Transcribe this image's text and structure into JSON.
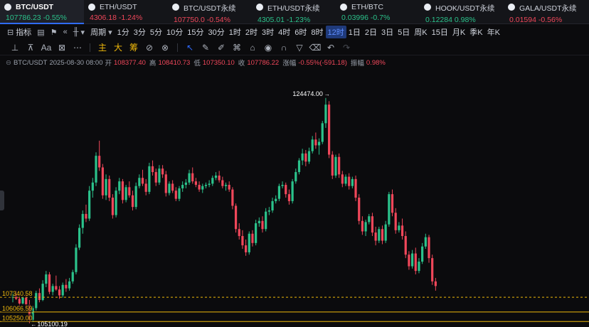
{
  "tickers": [
    {
      "symbol": "BTC/USDT",
      "price": "107786.23",
      "change": "-0.55%",
      "price_dir": "up",
      "change_dir": "up",
      "active": true
    },
    {
      "symbol": "ETH/USDT",
      "price": "4306.18",
      "change": "-1.24%",
      "price_dir": "down",
      "change_dir": "down",
      "active": false
    },
    {
      "symbol": "BTC/USDT永续",
      "price": "107750.0",
      "change": "-0.54%",
      "price_dir": "down",
      "change_dir": "down",
      "active": false
    },
    {
      "symbol": "ETH/USDT永续",
      "price": "4305.01",
      "change": "-1.23%",
      "price_dir": "up",
      "change_dir": "up",
      "active": false
    },
    {
      "symbol": "ETH/BTC",
      "price": "0.03996",
      "change": "-0.7%",
      "price_dir": "up",
      "change_dir": "up",
      "active": false
    },
    {
      "symbol": "HOOK/USDT永续",
      "price": "0.12284",
      "change": "0.98%",
      "price_dir": "up",
      "change_dir": "up",
      "active": false
    },
    {
      "symbol": "GALA/USDT永续",
      "price": "0.01594",
      "change": "-0.56%",
      "price_dir": "down",
      "change_dir": "down",
      "active": false
    }
  ],
  "toolbar": {
    "indicator_label": "指标",
    "period_label": "周期",
    "timeframes": [
      "1分",
      "3分",
      "5分",
      "10分",
      "15分",
      "30分",
      "1时",
      "2时",
      "3时",
      "4时",
      "6时",
      "8时",
      "12时",
      "1日",
      "2日",
      "3日",
      "5日",
      "周K",
      "15日",
      "月K",
      "季K",
      "年K"
    ],
    "selected_timeframe": "12时"
  },
  "drawing_tools": {
    "main_label": "主",
    "big_label": "大",
    "chip_label": "筹"
  },
  "info": {
    "pair": "BTC/USDT",
    "datetime": "2025-08-30 08:00",
    "open_label": "开",
    "open": "108377.40",
    "high_label": "高",
    "high": "108410.73",
    "low_label": "低",
    "low": "107350.10",
    "close_label": "收",
    "close": "107786.22",
    "change_label": "涨幅",
    "change": "-0.55%(-591.18)",
    "amplitude_label": "振幅",
    "amplitude": "0.98%"
  },
  "chart_data": {
    "type": "candlestick",
    "symbol": "BTC/USDT",
    "interval": "12时",
    "high_marker": "124474.00",
    "low_marker": "105100.19",
    "price_lines": [
      {
        "label": "107340.58",
        "value": 107340.58,
        "style": "dashed",
        "color": "#f0b90b"
      },
      {
        "label": "106066.59",
        "value": 106066.59,
        "style": "solid",
        "color": "#f0b90b"
      },
      {
        "label": "105250.00",
        "value": 105250.0,
        "style": "solid",
        "color": "#f0b90b"
      }
    ],
    "price_axis": {
      "min": 104900,
      "max": 125500
    },
    "colors": {
      "up": "#2bc28b",
      "down": "#f0475a",
      "line": "#f0b90b"
    },
    "ohlc": [
      [
        107300,
        107800,
        106900,
        107600
      ],
      [
        107600,
        107900,
        107100,
        107200
      ],
      [
        107200,
        107500,
        106500,
        106800
      ],
      [
        106800,
        107400,
        106700,
        107300
      ],
      [
        107300,
        107600,
        106400,
        106700
      ],
      [
        106700,
        107100,
        105100,
        105400
      ],
      [
        105400,
        106600,
        105200,
        106400
      ],
      [
        106400,
        107900,
        106200,
        107700
      ],
      [
        107700,
        108100,
        106900,
        107100
      ],
      [
        107100,
        108800,
        107000,
        108500
      ],
      [
        108500,
        109600,
        108200,
        109300
      ],
      [
        109300,
        109500,
        107600,
        107800
      ],
      [
        107800,
        108500,
        107500,
        108300
      ],
      [
        108300,
        109200,
        107900,
        108000
      ],
      [
        108000,
        108300,
        107200,
        107500
      ],
      [
        107500,
        108600,
        107300,
        108400
      ],
      [
        108400,
        108900,
        107800,
        108100
      ],
      [
        108100,
        109000,
        107900,
        108700
      ],
      [
        108700,
        109700,
        108500,
        109500
      ],
      [
        109500,
        111900,
        109300,
        111600
      ],
      [
        111600,
        113600,
        111400,
        113300
      ],
      [
        113300,
        114800,
        112800,
        114500
      ],
      [
        114500,
        115300,
        113800,
        114100
      ],
      [
        114100,
        116900,
        113900,
        116500
      ],
      [
        116500,
        117600,
        115900,
        117200
      ],
      [
        117200,
        119800,
        116900,
        119500
      ],
      [
        119500,
        120800,
        118200,
        118500
      ],
      [
        118500,
        118800,
        115800,
        116100
      ],
      [
        116100,
        117900,
        115700,
        117500
      ],
      [
        117500,
        117800,
        115600,
        115900
      ],
      [
        115900,
        116200,
        114100,
        114400
      ],
      [
        114400,
        116800,
        114200,
        116500
      ],
      [
        116500,
        117600,
        116200,
        117300
      ],
      [
        117300,
        117500,
        115400,
        115700
      ],
      [
        115700,
        117000,
        115500,
        116800
      ],
      [
        116800,
        117300,
        115900,
        116100
      ],
      [
        116100,
        116500,
        114800,
        115100
      ],
      [
        115100,
        117200,
        114900,
        116900
      ],
      [
        116900,
        117900,
        116700,
        117600
      ],
      [
        117600,
        118300,
        116900,
        117100
      ],
      [
        117100,
        117500,
        116100,
        116400
      ],
      [
        116400,
        118900,
        116200,
        118600
      ],
      [
        118600,
        119100,
        117800,
        118100
      ],
      [
        118100,
        118400,
        116900,
        117200
      ],
      [
        117200,
        118700,
        117000,
        118400
      ],
      [
        118400,
        118700,
        117600,
        117900
      ],
      [
        117900,
        118200,
        116000,
        116300
      ],
      [
        116300,
        117300,
        116100,
        117100
      ],
      [
        117100,
        117400,
        116300,
        116500
      ],
      [
        116500,
        116800,
        115600,
        115800
      ],
      [
        115800,
        116900,
        115600,
        116700
      ],
      [
        116700,
        117300,
        116400,
        117000
      ],
      [
        117000,
        117500,
        116700,
        117200
      ],
      [
        117200,
        118300,
        117000,
        118000
      ],
      [
        118000,
        118500,
        117100,
        117300
      ],
      [
        117300,
        117600,
        116800,
        117000
      ],
      [
        117000,
        117300,
        116400,
        116600
      ],
      [
        116600,
        117100,
        116300,
        116900
      ],
      [
        116900,
        117200,
        116700,
        117000
      ],
      [
        117000,
        117400,
        116800,
        117100
      ],
      [
        117100,
        117800,
        116900,
        117600
      ],
      [
        117600,
        118100,
        117400,
        117800
      ],
      [
        117800,
        118200,
        117200,
        117400
      ],
      [
        117400,
        117700,
        116700,
        116900
      ],
      [
        116900,
        117200,
        116500,
        117000
      ],
      [
        117000,
        117300,
        116400,
        116600
      ],
      [
        116600,
        116800,
        114900,
        115200
      ],
      [
        115200,
        115400,
        112900,
        113200
      ],
      [
        113200,
        113700,
        112300,
        112600
      ],
      [
        112600,
        113100,
        111500,
        111800
      ],
      [
        111800,
        112300,
        110900,
        111200
      ],
      [
        111200,
        113000,
        111000,
        112800
      ],
      [
        112800,
        113100,
        111700,
        112000
      ],
      [
        112000,
        114000,
        111800,
        113700
      ],
      [
        113700,
        114200,
        113400,
        113900
      ],
      [
        113900,
        114300,
        112900,
        113200
      ],
      [
        113200,
        115000,
        113000,
        114700
      ],
      [
        114700,
        115100,
        114400,
        114800
      ],
      [
        114800,
        115900,
        114600,
        115600
      ],
      [
        115600,
        116100,
        115400,
        115800
      ],
      [
        115800,
        117100,
        115600,
        116900
      ],
      [
        116900,
        117300,
        116700,
        117000
      ],
      [
        117000,
        117200,
        115900,
        116200
      ],
      [
        116200,
        116600,
        115300,
        115600
      ],
      [
        115600,
        117500,
        115400,
        117300
      ],
      [
        117300,
        118400,
        117100,
        118100
      ],
      [
        118100,
        119300,
        117900,
        119100
      ],
      [
        119100,
        120100,
        118700,
        119700
      ],
      [
        119700,
        120000,
        118600,
        119000
      ],
      [
        119000,
        120200,
        118800,
        119900
      ],
      [
        119900,
        121200,
        119700,
        120900
      ],
      [
        120900,
        121500,
        120100,
        120400
      ],
      [
        120400,
        121000,
        119600,
        120700
      ],
      [
        120700,
        122500,
        120500,
        122300
      ],
      [
        122300,
        124474,
        121900,
        123900
      ],
      [
        123900,
        124200,
        119300,
        119600
      ],
      [
        119600,
        119900,
        117500,
        117800
      ],
      [
        117800,
        119600,
        117600,
        119400
      ],
      [
        119400,
        119700,
        117600,
        117900
      ],
      [
        117900,
        118200,
        116800,
        117100
      ],
      [
        117100,
        117900,
        116900,
        117700
      ],
      [
        117700,
        118000,
        116600,
        116900
      ],
      [
        116900,
        117700,
        116700,
        117500
      ],
      [
        117500,
        117800,
        115600,
        115900
      ],
      [
        115900,
        116200,
        113600,
        113900
      ],
      [
        113900,
        114300,
        112700,
        113000
      ],
      [
        113000,
        114000,
        112600,
        113800
      ],
      [
        113800,
        114500,
        113600,
        114300
      ],
      [
        114300,
        114600,
        112600,
        112900
      ],
      [
        112900,
        113400,
        111800,
        112200
      ],
      [
        112200,
        113400,
        112000,
        113200
      ],
      [
        113200,
        113500,
        111900,
        112200
      ],
      [
        112200,
        113900,
        112000,
        113600
      ],
      [
        113600,
        116400,
        113400,
        116200
      ],
      [
        116200,
        116600,
        114300,
        114600
      ],
      [
        114600,
        115000,
        112800,
        113100
      ],
      [
        113100,
        113800,
        112900,
        113500
      ],
      [
        113500,
        114100,
        112300,
        112600
      ],
      [
        112600,
        113000,
        110700,
        111000
      ],
      [
        111000,
        111300,
        109700,
        110000
      ],
      [
        110000,
        111400,
        109800,
        111100
      ],
      [
        111100,
        111600,
        109300,
        109600
      ],
      [
        109600,
        110700,
        109400,
        110400
      ],
      [
        110400,
        112000,
        110200,
        111700
      ],
      [
        111700,
        112800,
        111500,
        112500
      ],
      [
        112500,
        112700,
        110300,
        110700
      ],
      [
        110700,
        111000,
        108400,
        108700
      ],
      [
        108700,
        109000,
        107900,
        108300
      ]
    ]
  }
}
